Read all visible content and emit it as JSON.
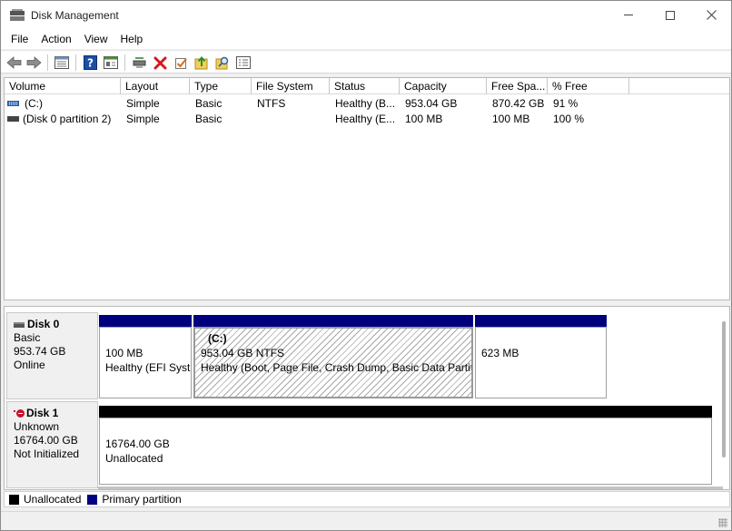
{
  "window": {
    "title": "Disk Management"
  },
  "menu": [
    "File",
    "Action",
    "View",
    "Help"
  ],
  "toolbar": {
    "icons": [
      "back-arrow-icon",
      "forward-arrow-icon",
      "list-view-icon",
      "help-icon",
      "properties-icon",
      "connect-disk-icon",
      "delete-icon",
      "check-icon",
      "up-folder-icon",
      "search-icon",
      "settings-icon"
    ],
    "colors": {
      "delete": "#d11a1a",
      "help": "#1c4fa5",
      "folder": "#e8b82c",
      "check": "#d1701a"
    }
  },
  "volumes": {
    "columns": [
      "Volume",
      "Layout",
      "Type",
      "File System",
      "Status",
      "Capacity",
      "Free Spa...",
      "% Free"
    ],
    "rows": [
      {
        "volume": "(C:)",
        "layout": "Simple",
        "type": "Basic",
        "fs": "NTFS",
        "status": "Healthy (B...",
        "capacity": "953.04 GB",
        "free": "870.42 GB",
        "pct": "91 %",
        "icon": "striped"
      },
      {
        "volume": "(Disk 0 partition 2)",
        "layout": "Simple",
        "type": "Basic",
        "fs": "",
        "status": "Healthy (E...",
        "capacity": "100 MB",
        "free": "100 MB",
        "pct": "100 %",
        "icon": "plain"
      }
    ]
  },
  "disks": [
    {
      "name": "Disk 0",
      "kind": "Basic",
      "size": "953.74 GB",
      "state": "Online",
      "partitions": [
        {
          "line1": "100 MB",
          "line2": "Healthy (EFI Syst"
        },
        {
          "title": "(C:)",
          "line1": "953.04 GB NTFS",
          "line2": "Healthy (Boot, Page File, Crash Dump, Basic Data Partitio"
        },
        {
          "line1": "623 MB",
          "line2": ""
        }
      ]
    },
    {
      "name": "Disk 1",
      "kind": "Unknown",
      "size": "16764.00 GB",
      "state": "Not Initialized",
      "partitions": [
        {
          "line1": "16764.00 GB",
          "line2": "Unallocated"
        }
      ]
    }
  ],
  "legend": [
    {
      "label": "Unallocated",
      "color": "#000000"
    },
    {
      "label": "Primary partition",
      "color": "#00007f"
    }
  ]
}
